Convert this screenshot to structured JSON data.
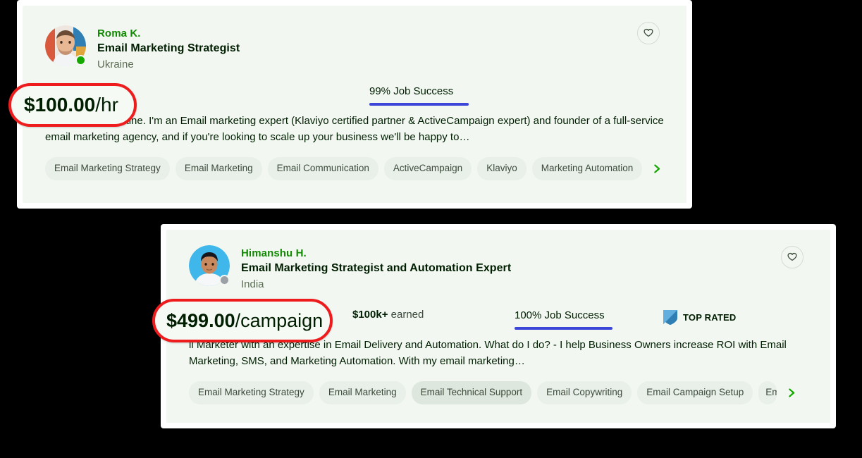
{
  "cards": [
    {
      "name": "Roma K.",
      "title": "Email Marketing Strategist",
      "country": "Ukraine",
      "status": "online",
      "rate": "$100.00/hr",
      "rate_amount": "$100.00",
      "rate_unit": "/hr",
      "earned": "",
      "job_success_label": "99% Job Success",
      "job_success_percent": 99,
      "top_rated_label": "",
      "description": "and I'm from Ukraine. I'm an Email marketing expert (Klaviyo certified partner & ActiveCampaign expert) and founder of a full-service email marketing agency, and if you're looking to scale up your business we'll be happy to…",
      "tags": [
        "Email Marketing Strategy",
        "Email Marketing",
        "Email Communication",
        "ActiveCampaign",
        "Klaviyo",
        "Marketing Automation"
      ],
      "more_tags_icon": "chevron-right-icon",
      "favorite_icon": "heart-outline-icon"
    },
    {
      "name": "Himanshu H.",
      "title": "Email Marketing Strategist and Automation Expert",
      "country": "India",
      "status": "offline",
      "rate": "$499.00/campaign",
      "rate_amount": "$499.00",
      "rate_unit": "/campaign",
      "earned_amount": "$100k+",
      "earned_suffix": " earned",
      "job_success_label": "100% Job Success",
      "job_success_percent": 100,
      "top_rated_label": "TOP RATED",
      "top_rated_icon": "shield-badge-icon",
      "description": "il Marketer with an expertise in Email Delivery and Automation. What do I do? - I help Business Owners increase ROI with Email Marketing, SMS, and Marketing Automation. With my email marketing…",
      "tags": [
        "Email Marketing Strategy",
        "Email Marketing",
        "Email Technical Support",
        "Email Copywriting",
        "Email Campaign Setup",
        "Em"
      ],
      "hovered_tag_index": 2,
      "more_tags_icon": "chevron-right-icon",
      "favorite_icon": "heart-outline-icon"
    }
  ],
  "highlights": [
    {
      "amount": "$100.00",
      "unit": "/hr"
    },
    {
      "amount": "$499.00",
      "unit": "/campaign"
    }
  ],
  "colors": {
    "background": "#000000",
    "card_frame": "#ffffff",
    "card_surface": "#f2f7f2",
    "name_green": "#108a00",
    "accent_green": "#14a800",
    "job_success_bar": "#3c47d9",
    "highlight_red": "#ee1c1c",
    "status_online": "#14a800",
    "status_offline": "#9aa0a6",
    "tag_bg": "#e9f0e9",
    "top_rated_shield": "#3c8dc4"
  }
}
